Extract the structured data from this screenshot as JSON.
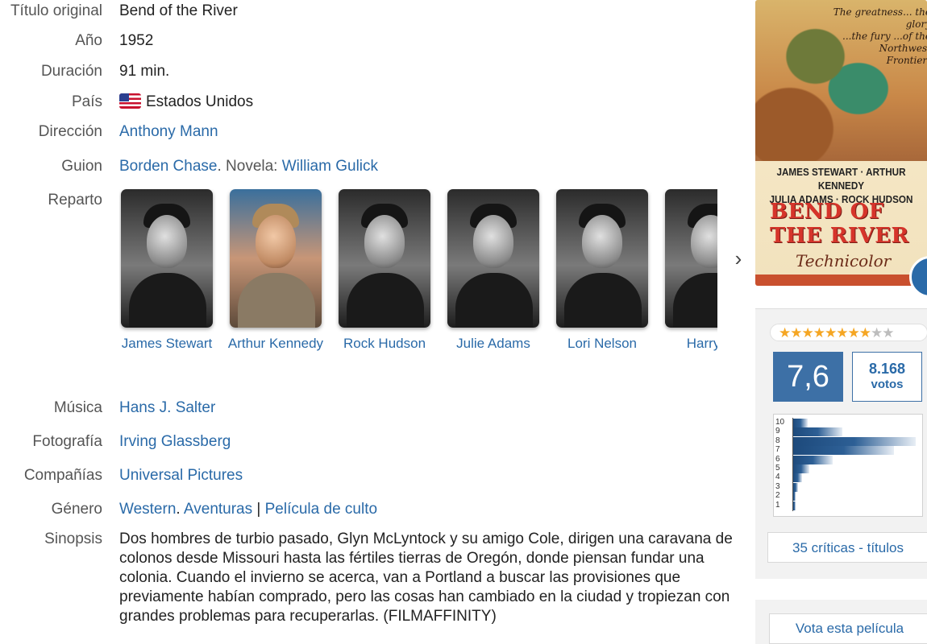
{
  "details": {
    "original_title": {
      "label": "Título original",
      "value": "Bend of the River"
    },
    "year": {
      "label": "Año",
      "value": "1952"
    },
    "duration": {
      "label": "Duración",
      "value": "91 min."
    },
    "country": {
      "label": "País",
      "value": "Estados Unidos",
      "flag_icon": "us-flag-icon"
    },
    "director": {
      "label": "Dirección",
      "value": "Anthony Mann"
    },
    "screenplay": {
      "label": "Guion",
      "writer": "Borden Chase",
      "separator": ". Novela: ",
      "novel": "William Gulick"
    },
    "cast_label": "Reparto",
    "music": {
      "label": "Música",
      "value": "Hans J. Salter"
    },
    "photography": {
      "label": "Fotografía",
      "value": "Irving Glassberg"
    },
    "companies": {
      "label": "Compañías",
      "value": "Universal Pictures"
    },
    "genre": {
      "label": "Género",
      "genre1": "Western",
      "sep1": ". ",
      "genre2": "Aventuras",
      "sep2": " | ",
      "topic": "Película de culto"
    },
    "synopsis": {
      "label": "Sinopsis",
      "text": "Dos hombres de turbio pasado, Glyn McLyntock y su amigo Cole, dirigen una caravana de colonos desde Missouri hasta las fértiles tierras de Oregón, donde piensan fundar una colonia. Cuando el invierno se acerca, van a Portland a buscar las provisiones que previamente habían comprado, pero las cosas han cambiado en la ciudad y tropiezan con grandes problemas para recuperarlas. (FILMAFFINITY)"
    }
  },
  "cast": [
    {
      "name": "James Stewart",
      "photo": "bw"
    },
    {
      "name": "Arthur Kennedy",
      "photo": "color"
    },
    {
      "name": "Rock Hudson",
      "photo": "bw"
    },
    {
      "name": "Julie Adams",
      "photo": "bw"
    },
    {
      "name": "Lori Nelson",
      "photo": "bw"
    },
    {
      "name": "Harry M",
      "photo": "bw"
    }
  ],
  "cast_next_icon": "chevron-right-icon",
  "poster": {
    "tagline": "The greatness... the glory\n...the fury ...of the\nNorthwest\nFrontier!",
    "credits_line1": "JAMES STEWART · ARTHUR KENNEDY",
    "credits_line2": "JULIA ADAMS · ROCK HUDSON",
    "title_line1": "BEND OF",
    "title_line2": "THE RIVER",
    "color_by": "Technicolor"
  },
  "rating": {
    "stars_filled": 8,
    "stars_total": 10,
    "average": "7,6",
    "votes_count": "8.168",
    "votes_label": "votos",
    "histogram": [
      {
        "score": "10",
        "fraction": 0.12
      },
      {
        "score": "9",
        "fraction": 0.4
      },
      {
        "score": "8",
        "fraction": 1.0
      },
      {
        "score": "7",
        "fraction": 0.82
      },
      {
        "score": "6",
        "fraction": 0.32
      },
      {
        "score": "5",
        "fraction": 0.13
      },
      {
        "score": "4",
        "fraction": 0.07
      },
      {
        "score": "3",
        "fraction": 0.04
      },
      {
        "score": "2",
        "fraction": 0.02
      },
      {
        "score": "1",
        "fraction": 0.02
      }
    ]
  },
  "critics_link": "35 críticas - títulos",
  "vote_button": "Vota esta película",
  "colors": {
    "link": "#2a6aa8",
    "rating_blue": "#3d70a6",
    "star": "#f5a623",
    "panel_bg": "#f2f2f2"
  }
}
